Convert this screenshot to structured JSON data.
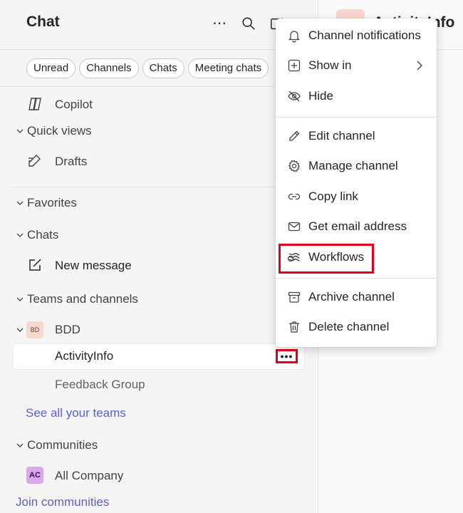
{
  "header": {
    "title": "Chat"
  },
  "filters": [
    "Unread",
    "Channels",
    "Chats",
    "Meeting chats"
  ],
  "sidebar": {
    "copilot": "Copilot",
    "quick_views": "Quick views",
    "drafts": "Drafts",
    "favorites": "Favorites",
    "chats": "Chats",
    "new_message": "New message",
    "teams_and_channels": "Teams and channels",
    "team_avatar": "BD",
    "team_name": "BDD",
    "channel_selected": "ActivityInfo",
    "channel_other": "Feedback Group",
    "see_all_teams": "See all your teams",
    "communities": "Communities",
    "community_avatar": "AC",
    "community_name": "All Company",
    "join_communities": "Join communities",
    "more_options": "•••"
  },
  "right_pane": {
    "title": "ActivityInfo"
  },
  "context_menu": {
    "items": [
      "Channel notifications",
      "Show in",
      "Hide",
      "Edit channel",
      "Manage channel",
      "Copy link",
      "Get email address",
      "Workflows",
      "Archive channel",
      "Delete channel"
    ]
  },
  "colors": {
    "accent_link": "#5b5fc7",
    "highlight": "#e0001b"
  }
}
